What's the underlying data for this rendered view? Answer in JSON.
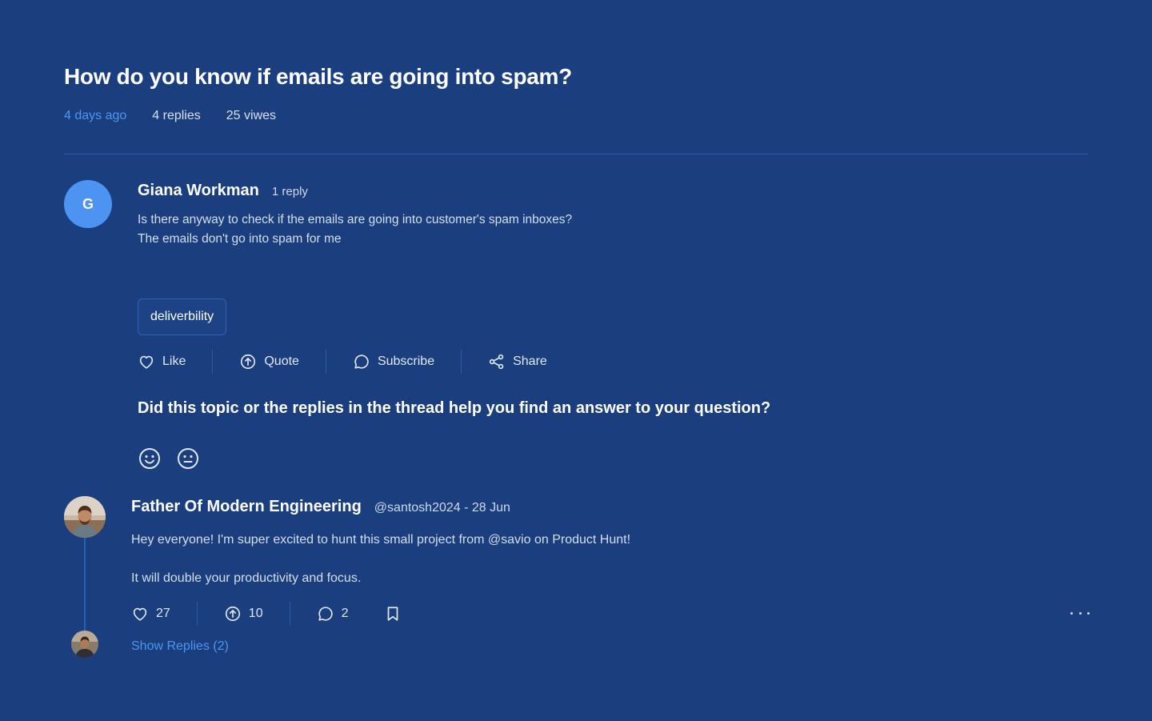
{
  "topic": {
    "title": "How do you know if emails are going into spam?",
    "time_ago": "4 days ago",
    "replies": "4 replies",
    "views": "25 viwes"
  },
  "post": {
    "avatar_initial": "G",
    "author": "Giana Workman",
    "reply_count": "1 reply",
    "body_line1": "Is there anyway to check if the emails are going into customer's spam inboxes?",
    "body_line2": "The emails don't go into spam for me",
    "tag": "deliverbility",
    "actions": {
      "like": "Like",
      "quote": "Quote",
      "subscribe": "Subscribe",
      "share": "Share"
    }
  },
  "feedback": {
    "question": "Did this topic or the replies in the thread help you find an answer to your question?",
    "icons": [
      "smile-icon",
      "neutral-face-icon"
    ]
  },
  "comment": {
    "author": "Father Of Modern Engineering",
    "handle_date": "@santosh2024 - 28 Jun",
    "line1": "Hey everyone! I'm super excited to hunt this small project from @savio on Product Hunt!",
    "line2": "It will double your productivity and focus.",
    "likes": "27",
    "upvotes": "10",
    "comments": "2",
    "show_replies": "Show Replies (2)"
  },
  "colors": {
    "background": "#1b3f7e",
    "accent": "#4f95f0",
    "avatar": "#4d94f2"
  }
}
